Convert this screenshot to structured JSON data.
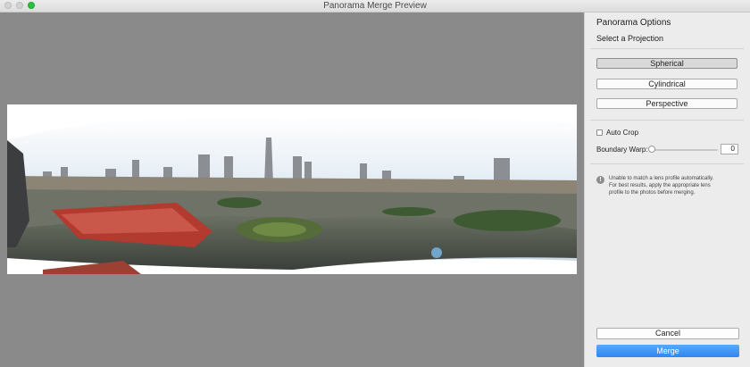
{
  "window": {
    "title": "Panorama Merge Preview"
  },
  "panel": {
    "heading": "Panorama Options",
    "subheading": "Select a Projection",
    "projections": [
      {
        "label": "Spherical",
        "selected": true
      },
      {
        "label": "Cylindrical",
        "selected": false
      },
      {
        "label": "Perspective",
        "selected": false
      }
    ],
    "auto_crop": {
      "label": "Auto Crop",
      "checked": false
    },
    "boundary_warp": {
      "label": "Boundary Warp:",
      "value": "0"
    },
    "warning": "Unable to match a lens profile automatically. For best results, apply the appropriate lens profile to the photos before merging.",
    "cancel_label": "Cancel",
    "merge_label": "Merge"
  },
  "icons": {
    "warning": "info-icon",
    "close": "close-icon",
    "minimize": "minimize-icon",
    "zoom": "zoom-icon"
  },
  "colors": {
    "accent": "#2f86f0",
    "preview_bg": "#8a8a8a"
  }
}
